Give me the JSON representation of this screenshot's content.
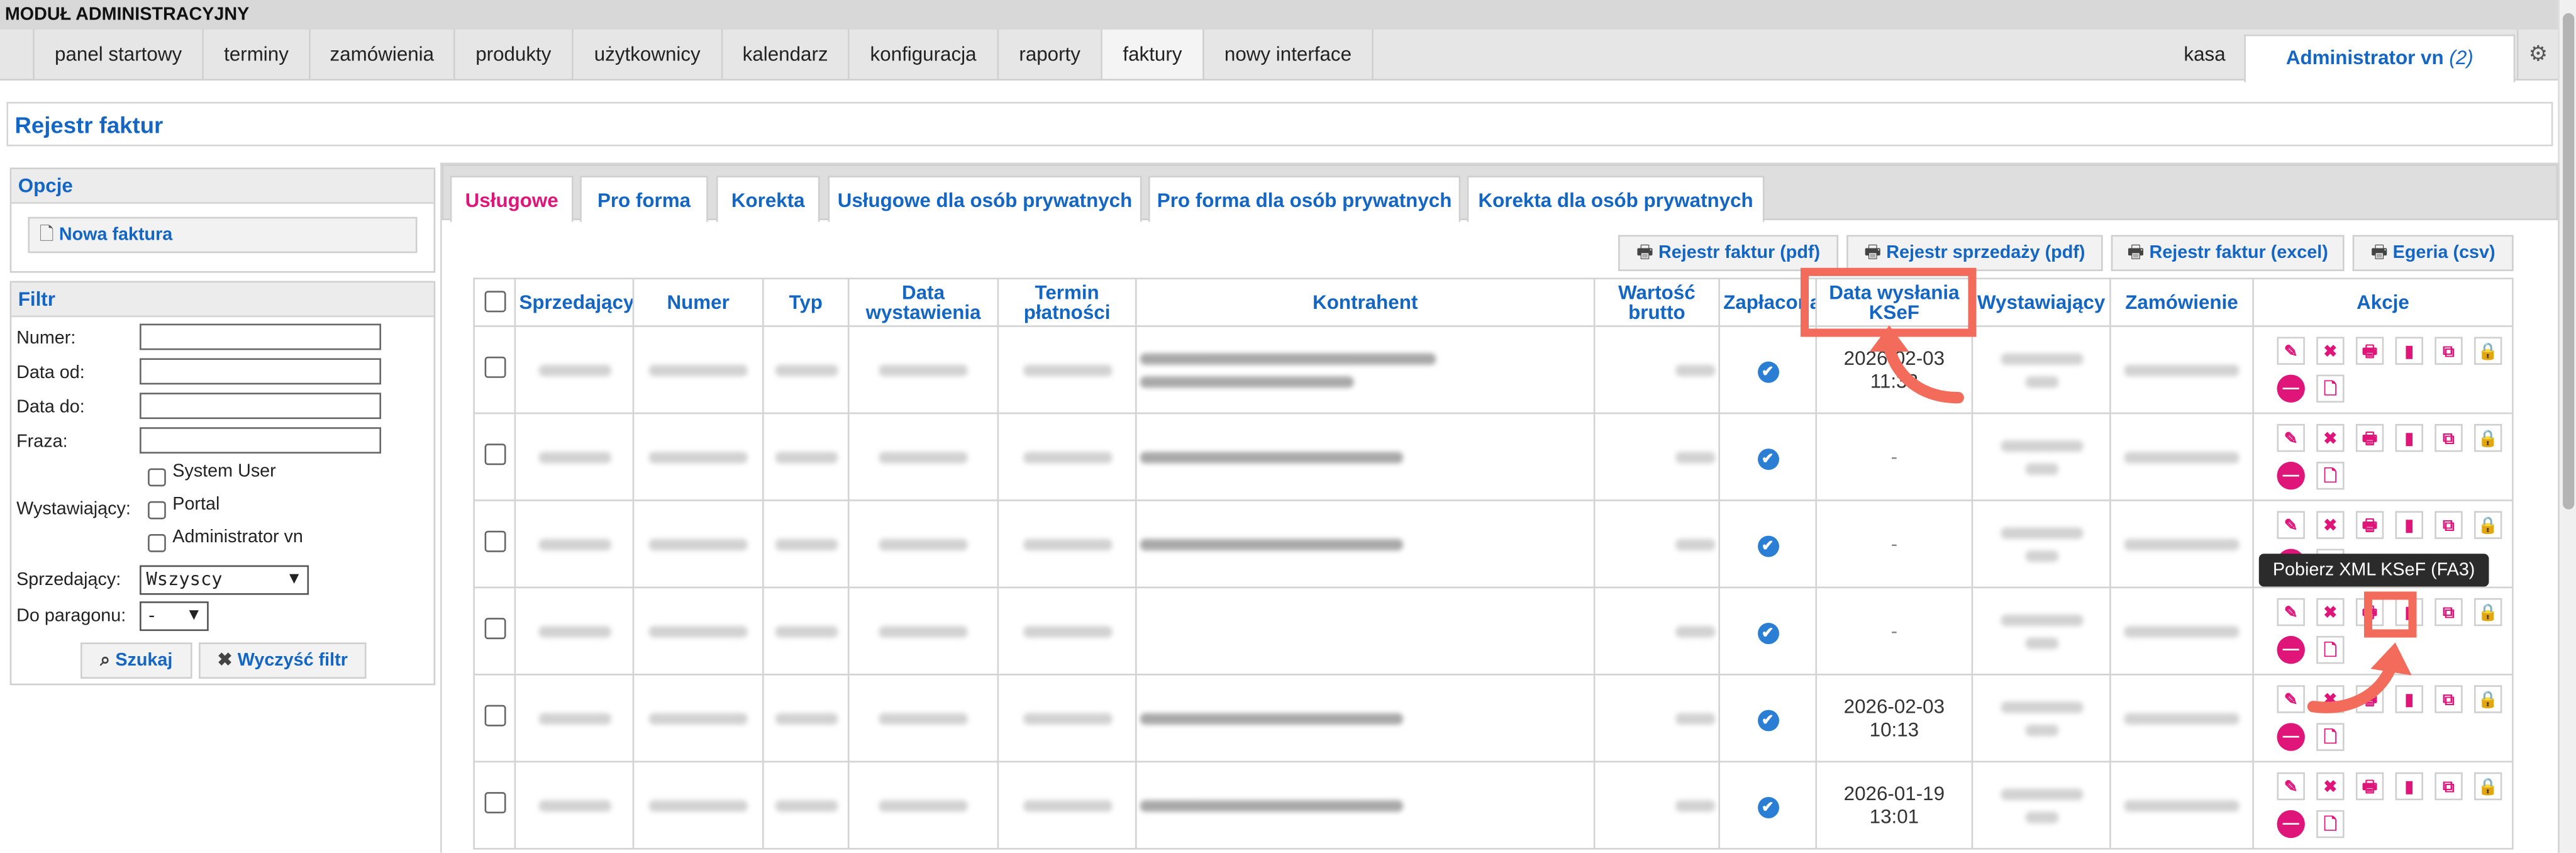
{
  "header": {
    "module_title": "MODUŁ ADMINISTRACYJNY"
  },
  "nav": {
    "items": [
      "panel startowy",
      "terminy",
      "zamówienia",
      "produkty",
      "użytkownicy",
      "kalendarz",
      "konfiguracja",
      "raporty",
      "faktury",
      "nowy interface"
    ],
    "active": "faktury",
    "kasa": "kasa",
    "user": "Administrator vn",
    "user_count": "(2)",
    "settings_icon": "gear-icon"
  },
  "page": {
    "title": "Rejestr faktur"
  },
  "options": {
    "heading": "Opcje",
    "new_invoice": "Nowa faktura"
  },
  "filter": {
    "heading": "Filtr",
    "labels": {
      "numer": "Numer:",
      "data_od": "Data od:",
      "data_do": "Data do:",
      "fraza": "Fraza:",
      "wystawiajacy": "Wystawiający:",
      "sprzedajacy": "Sprzedający:",
      "do_paragonu": "Do paragonu:"
    },
    "issuers": [
      "System User",
      "Portal",
      "Administrator vn"
    ],
    "seller_selected": "Wszyscy",
    "receipt_selected": "-",
    "search_button": "Szukaj",
    "clear_button": "Wyczyść filtr"
  },
  "tabs": [
    "Usługowe",
    "Pro forma",
    "Korekta",
    "Usługowe dla osób prywatnych",
    "Pro forma dla osób prywatnych",
    "Korekta dla osób prywatnych"
  ],
  "active_tab": "Usługowe",
  "exports": [
    "Rejestr faktur (pdf)",
    "Rejestr sprzedaży (pdf)",
    "Rejestr faktur (excel)",
    "Egeria (csv)"
  ],
  "table": {
    "columns": [
      "Sprzedający",
      "Numer",
      "Typ",
      "Data wystawienia",
      "Termin płatności",
      "Kontrahent",
      "Wartość brutto",
      "Zapłacona",
      "Data wysłania KSeF",
      "Wystawiający",
      "Zamówienie",
      "Akcje"
    ],
    "rows": [
      {
        "ksef": "2026-02-03 11:32",
        "paid": true
      },
      {
        "ksef": "-",
        "paid": true
      },
      {
        "ksef": "-",
        "paid": true
      },
      {
        "ksef": "-",
        "paid": true
      },
      {
        "ksef": "2026-02-03 10:13",
        "paid": true
      },
      {
        "ksef": "2026-01-19 13:01",
        "paid": true
      }
    ],
    "action_icons": [
      "edit-icon",
      "delete-icon",
      "print-icon",
      "xml-ksef-icon",
      "copy-icon",
      "lock-icon"
    ]
  },
  "tooltip": "Pobierz XML KSeF (FA3)",
  "colors": {
    "accent": "#1466c4",
    "pink": "#e0157a",
    "highlight": "#f26b5b"
  }
}
